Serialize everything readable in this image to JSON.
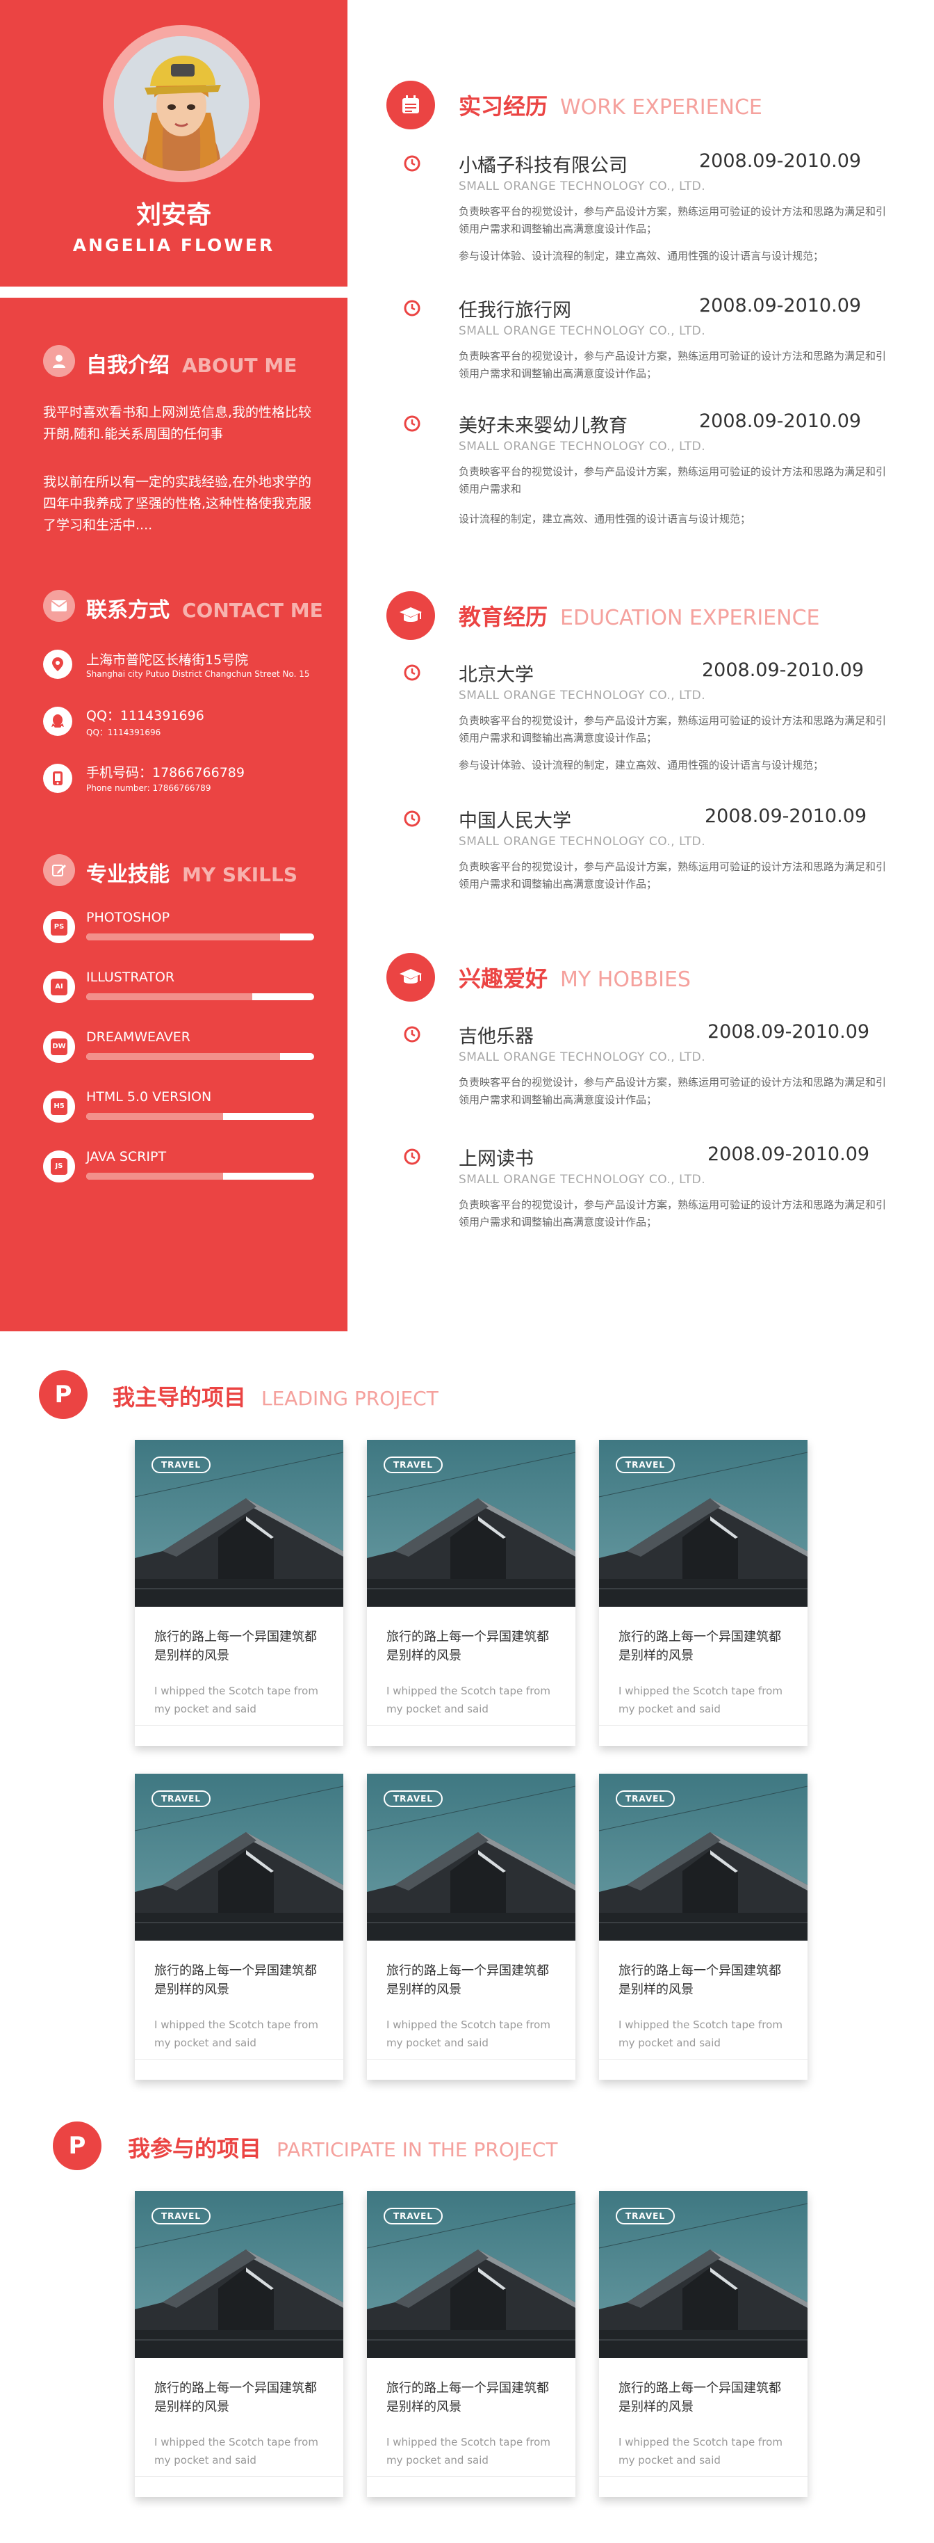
{
  "profile": {
    "name_cn": "刘安奇",
    "name_en": "ANGELIA FLOWER"
  },
  "about": {
    "title": "自我介绍",
    "title_en": "ABOUT ME",
    "para1": "我平时喜欢看书和上网浏览信息,我的性格比较开朗,随和.能关系周围的任何事",
    "para2": "我以前在所以有一定的实践经验,在外地求学的四年中我养成了坚强的性格,这种性格使我克服了学习和生活中...."
  },
  "contact": {
    "title": "联系方式",
    "title_en": "CONTACT ME",
    "items": [
      {
        "main": "上海市普陀区长椿街15号院",
        "sub": "Shanghai city Putuo District Changchun Street No. 15",
        "icon": "location-icon"
      },
      {
        "main": "QQ：1114391696",
        "sub": "QQ：1114391696",
        "icon": "qq-icon"
      },
      {
        "main": "手机号码：17866766789",
        "sub": "Phone number: 17866766789",
        "icon": "phone-icon"
      }
    ]
  },
  "skills": {
    "title": "专业技能",
    "title_en": "MY SKILLS",
    "items": [
      {
        "name": "PHOTOSHOP",
        "abbr": "PS",
        "level": 0.85
      },
      {
        "name": "ILLUSTRATOR",
        "abbr": "AI",
        "level": 0.73
      },
      {
        "name": "DREAMWEAVER",
        "abbr": "DW",
        "level": 0.85
      },
      {
        "name": "HTML 5.0 VERSION",
        "abbr": "H5",
        "level": 0.6
      },
      {
        "name": "JAVA SCRIPT",
        "abbr": "JS",
        "level": 0.6
      }
    ]
  },
  "work": {
    "title": "实习经历",
    "title_en": "WORK EXPERIENCE",
    "entries": [
      {
        "name": "小橘子科技有限公司",
        "date": "2008.09-2010.09",
        "company": "SMALL ORANGE TECHNOLOGY CO., LTD.",
        "desc1": "负责映客平台的视觉设计，参与产品设计方案，熟练运用可验证的设计方法和思路为满足和引领用户需求和调整输出高满意度设计作品；",
        "desc2": "参与设计体验、设计流程的制定，建立高效、通用性强的设计语言与设计规范；"
      },
      {
        "name": "任我行旅行网",
        "date": "2008.09-2010.09",
        "company": "SMALL ORANGE TECHNOLOGY CO., LTD.",
        "desc1": "负责映客平台的视觉设计，参与产品设计方案，熟练运用可验证的设计方法和思路为满足和引领用户需求和调整输出高满意度设计作品；",
        "desc2": ""
      },
      {
        "name": "美好未来婴幼儿教育",
        "date": "2008.09-2010.09",
        "company": "SMALL ORANGE TECHNOLOGY CO., LTD.",
        "desc1": "负责映客平台的视觉设计，参与产品设计方案，熟练运用可验证的设计方法和思路为满足和引领用户需求和",
        "desc2": "设计流程的制定，建立高效、通用性强的设计语言与设计规范；"
      }
    ]
  },
  "education": {
    "title": "教育经历",
    "title_en": "EDUCATION EXPERIENCE",
    "entries": [
      {
        "name": "北京大学",
        "date": "2008.09-2010.09",
        "company": "SMALL ORANGE TECHNOLOGY CO., LTD.",
        "desc1": "负责映客平台的视觉设计，参与产品设计方案，熟练运用可验证的设计方法和思路为满足和引领用户需求和调整输出高满意度设计作品；",
        "desc2": "参与设计体验、设计流程的制定，建立高效、通用性强的设计语言与设计规范；"
      },
      {
        "name": "中国人民大学",
        "date": "2008.09-2010.09",
        "company": "SMALL ORANGE TECHNOLOGY CO., LTD.",
        "desc1": "负责映客平台的视觉设计，参与产品设计方案，熟练运用可验证的设计方法和思路为满足和引领用户需求和调整输出高满意度设计作品；",
        "desc2": ""
      }
    ]
  },
  "hobbies": {
    "title": "兴趣爱好",
    "title_en": "MY HOBBIES",
    "entries": [
      {
        "name": "吉他乐器",
        "date": "2008.09-2010.09",
        "company": "SMALL ORANGE TECHNOLOGY CO., LTD.",
        "desc1": "负责映客平台的视觉设计，参与产品设计方案，熟练运用可验证的设计方法和思路为满足和引领用户需求和调整输出高满意度设计作品；",
        "desc2": ""
      },
      {
        "name": "上网读书",
        "date": "2008.09-2010.09",
        "company": "SMALL ORANGE TECHNOLOGY CO., LTD.",
        "desc1": "负责映客平台的视觉设计，参与产品设计方案，熟练运用可验证的设计方法和思路为满足和引领用户需求和调整输出高满意度设计作品；",
        "desc2": ""
      }
    ]
  },
  "leading_project": {
    "icon_letter": "P",
    "title": "我主导的项目",
    "title_en": "LEADING PROJECT"
  },
  "participate_project": {
    "icon_letter": "P",
    "title": "我参与的项目",
    "title_en": "PARTICIPATE IN THE PROJECT"
  },
  "card": {
    "tag": "TRAVEL",
    "title": "旅行的路上每一个异国建筑都是别样的风景",
    "subtitle": "I whipped the Scotch tape from my pocket and said"
  }
}
